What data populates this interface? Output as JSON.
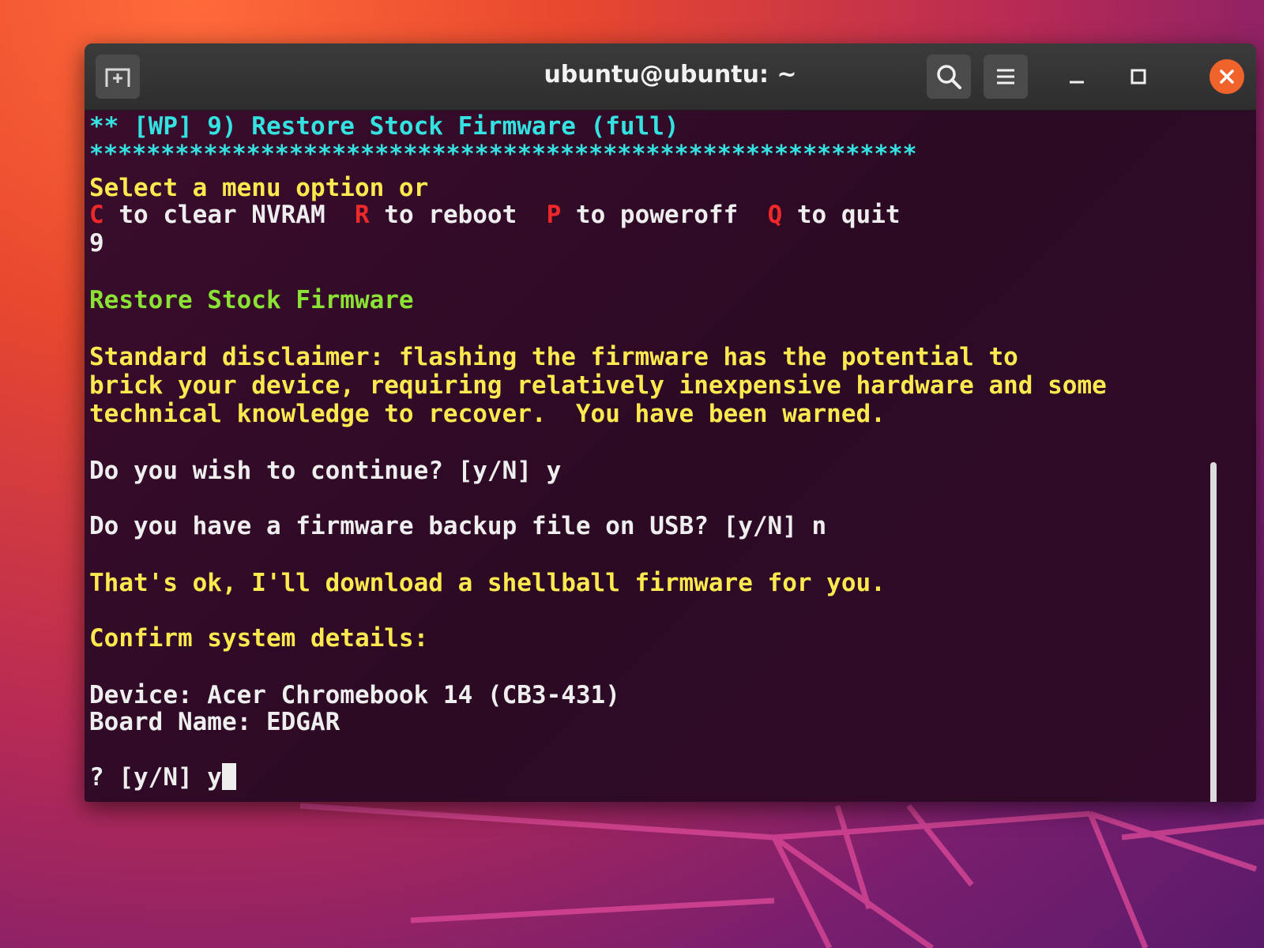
{
  "window": {
    "title": "ubuntu@ubuntu: ~",
    "icons": {
      "new_tab": "new-tab-icon",
      "search": "search-icon",
      "menu": "hamburger-menu-icon",
      "minimize": "minimize-icon",
      "maximize": "maximize-icon",
      "close": "close-icon"
    },
    "colors": {
      "close": "#f0642c",
      "titlebar": "#2e2e2e"
    }
  },
  "terminal": {
    "header": "** [WP] 9) Restore Stock Firmware (full)",
    "separator": "**********************************************************",
    "select_prompt": "Select a menu option or",
    "options": {
      "c_key": "C",
      "c_text": " to clear NVRAM  ",
      "r_key": "R",
      "r_text": " to reboot  ",
      "p_key": "P",
      "p_text": " to poweroff  ",
      "q_key": "Q",
      "q_text": " to quit"
    },
    "choice": "9",
    "section_title": "Restore Stock Firmware",
    "disclaimer": [
      "Standard disclaimer: flashing the firmware has the potential to",
      "brick your device, requiring relatively inexpensive hardware and some",
      "technical knowledge to recover.  You have been warned."
    ],
    "continue_prompt": "Do you wish to continue? [y/N] y",
    "usb_prompt": "Do you have a firmware backup file on USB? [y/N] n",
    "download_msg": "That's ok, I'll download a shellball firmware for you.",
    "confirm_title": "Confirm system details:",
    "device": "Device: Acer Chromebook 14 (CB3-431)",
    "board": "Board Name: EDGAR",
    "final_prompt": "? [y/N] y"
  },
  "colors": {
    "cyan": "#34e2e2",
    "green": "#8ae234",
    "yellow": "#fce94f",
    "red": "#ef2929",
    "text": "#eeeeee",
    "background": "#2c0a24"
  }
}
